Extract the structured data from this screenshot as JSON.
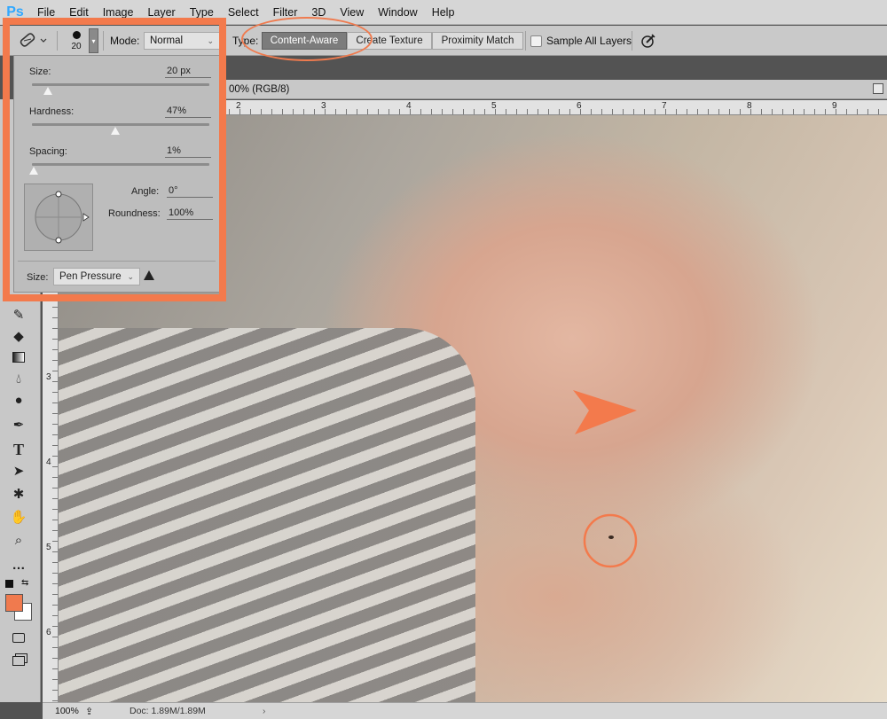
{
  "menubar": {
    "logo": "Ps",
    "items": [
      "File",
      "Edit",
      "Image",
      "Layer",
      "Type",
      "Select",
      "Filter",
      "3D",
      "View",
      "Window",
      "Help"
    ]
  },
  "options": {
    "brush_size": "20",
    "mode_label": "Mode:",
    "mode_value": "Normal",
    "type_label": "Type:",
    "type_buttons": [
      "Content-Aware",
      "Create Texture",
      "Proximity Match"
    ],
    "sample_all_layers": "Sample All Layers"
  },
  "document": {
    "tab_title": "00% (RGB/8)"
  },
  "rulers": {
    "top": [
      "2",
      "3",
      "4",
      "5",
      "6",
      "7",
      "8",
      "9"
    ],
    "left": [
      "3",
      "4",
      "5",
      "6"
    ]
  },
  "brush_panel": {
    "size_label": "Size:",
    "size_value": "20 px",
    "hardness_label": "Hardness:",
    "hardness_value": "47%",
    "spacing_label": "Spacing:",
    "spacing_value": "1%",
    "angle_label": "Angle:",
    "angle_value": "0°",
    "roundness_label": "Roundness:",
    "roundness_value": "100%",
    "size_control_label": "Size:",
    "size_control_value": "Pen Pressure",
    "size_fraction": 0.09,
    "hardness_fraction": 0.47,
    "spacing_fraction": 0.01
  },
  "statusbar": {
    "zoom": "100%",
    "doc_info": "Doc: 1.89M/1.89M"
  },
  "colors": {
    "annotation": "#f37a4c",
    "foreground": "#f07a4e",
    "background": "#ffffff"
  }
}
